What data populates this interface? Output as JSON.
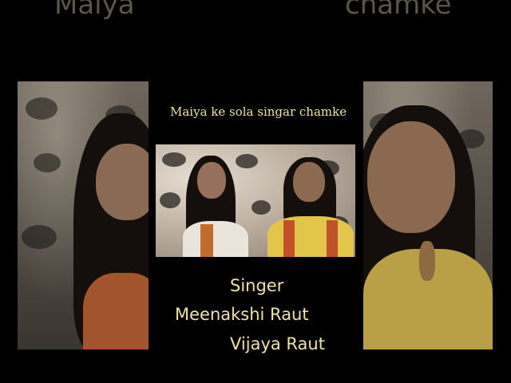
{
  "background": {
    "top_text_left": "Maiya",
    "top_text_right": "chamke"
  },
  "video": {
    "title": "Maiya ke sola singar chamke"
  },
  "credits": {
    "heading": "Singer",
    "names": [
      "Meenakshi Raut",
      "Vijaya Raut"
    ]
  },
  "colors": {
    "background": "#000000",
    "text_accent": "#efe2a6"
  }
}
